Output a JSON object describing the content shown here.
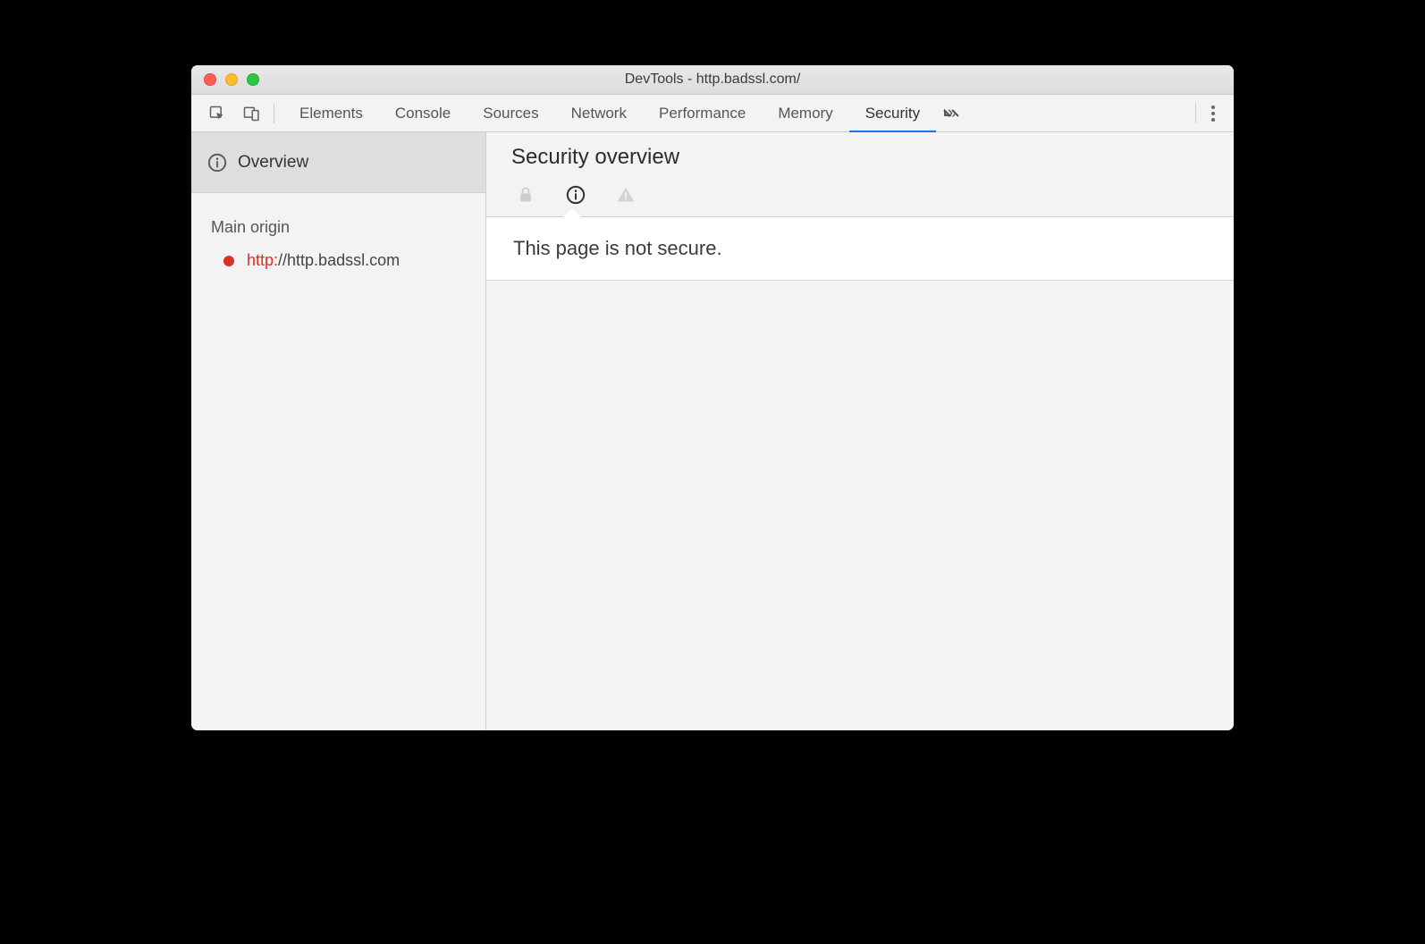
{
  "window": {
    "title": "DevTools - http.badssl.com/"
  },
  "tabs": {
    "items": [
      {
        "label": "Elements"
      },
      {
        "label": "Console"
      },
      {
        "label": "Sources"
      },
      {
        "label": "Network"
      },
      {
        "label": "Performance"
      },
      {
        "label": "Memory"
      },
      {
        "label": "Security"
      }
    ],
    "active": "Security"
  },
  "sidebar": {
    "overview_label": "Overview",
    "section_label": "Main origin",
    "origin": {
      "scheme": "http:",
      "rest": "//http.badssl.com",
      "status_color": "#d93025"
    }
  },
  "main": {
    "title": "Security overview",
    "message": "This page is not secure."
  }
}
